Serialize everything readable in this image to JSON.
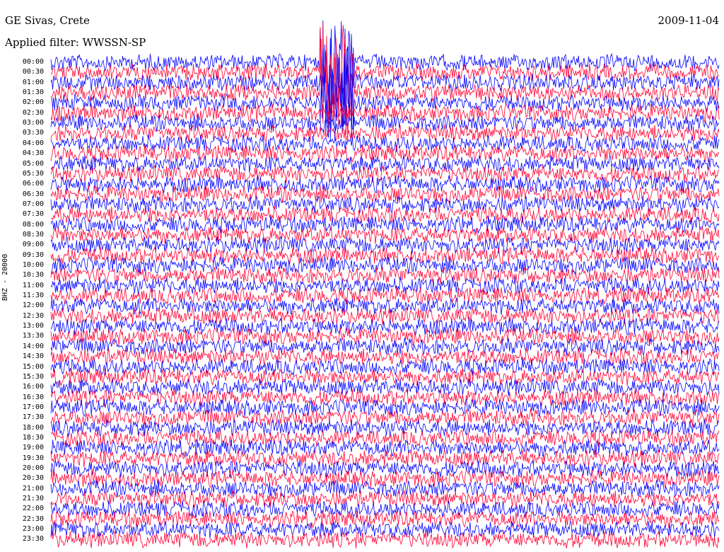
{
  "header": {
    "station": "GE Sivas, Crete",
    "filter": "Applied filter: WWSSN-SP",
    "date": "2009-11-04",
    "channel": "BHZ - 20000"
  },
  "colors": {
    "trace_a": "#0000ff",
    "trace_b": "#ff0033",
    "background": "#ffffff"
  },
  "chart_data": {
    "type": "line",
    "title": "GE Sivas, Crete",
    "subtitle": "Applied filter: WWSSN-SP",
    "ylabel": "BHZ - 20000",
    "date": "2009-11-04",
    "row_labels": [
      "00:00",
      "00:30",
      "01:00",
      "01:30",
      "02:00",
      "02:30",
      "03:00",
      "03:30",
      "04:00",
      "04:30",
      "05:00",
      "05:30",
      "06:00",
      "06:30",
      "07:00",
      "07:30",
      "08:00",
      "08:30",
      "09:00",
      "09:30",
      "10:00",
      "10:30",
      "11:00",
      "11:30",
      "12:00",
      "12:30",
      "13:00",
      "13:30",
      "14:00",
      "14:30",
      "15:00",
      "15:30",
      "16:00",
      "16:30",
      "17:00",
      "17:30",
      "18:00",
      "18:30",
      "19:00",
      "19:30",
      "20:00",
      "20:30",
      "21:00",
      "21:30",
      "22:00",
      "22:30",
      "23:00",
      "23:30"
    ],
    "row_colors": [
      "trace_a",
      "trace_b"
    ],
    "event": {
      "rows": [
        "00:00",
        "00:30",
        "01:00",
        "01:30",
        "02:00"
      ],
      "position_fraction": 0.41,
      "description": "large amplitude burst"
    }
  }
}
